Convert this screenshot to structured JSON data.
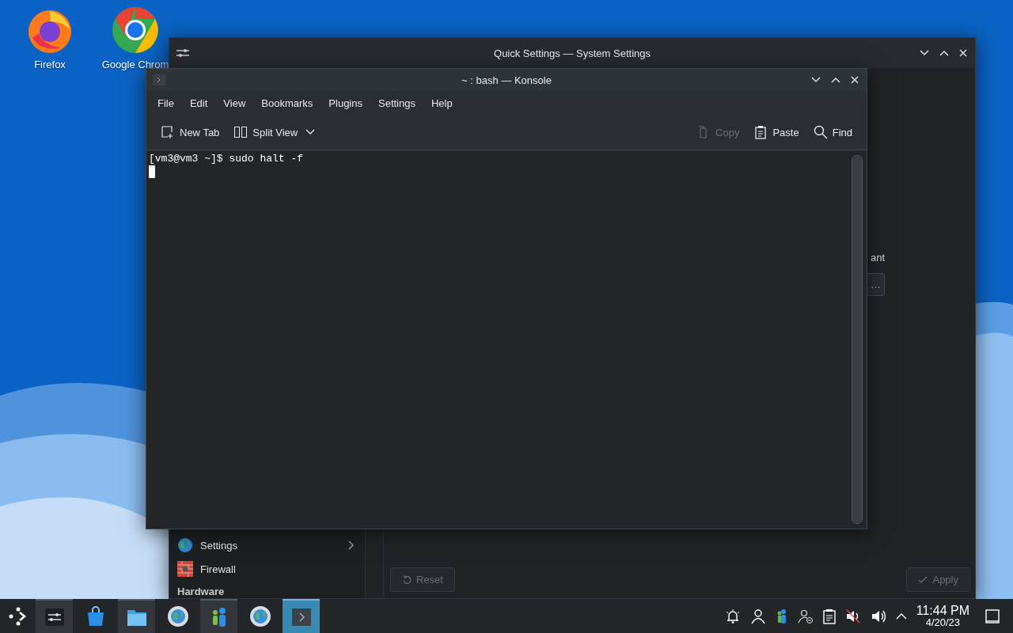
{
  "desktop_icons": [
    {
      "kind": "firefox",
      "label": "Firefox"
    },
    {
      "kind": "chrome",
      "label": "Google Chrom"
    }
  ],
  "settings_window": {
    "title": "Quick Settings — System Settings",
    "sidebar": {
      "items": [
        {
          "kind": "globe",
          "label": "Settings",
          "has_children": true
        },
        {
          "kind": "firewall",
          "label": "Firewall",
          "has_children": false
        }
      ],
      "section_heading": "Hardware"
    },
    "content": {
      "label": "ant",
      "button": "…"
    },
    "buttons": [
      {
        "kind": "reset",
        "label": "Reset",
        "disabled": true
      },
      {
        "kind": "apply",
        "label": "Apply",
        "disabled": true
      }
    ]
  },
  "konsole": {
    "title": "~ : bash — Konsole",
    "menu": [
      "File",
      "Edit",
      "View",
      "Bookmarks",
      "Plugins",
      "Settings",
      "Help"
    ],
    "toolbar_left": [
      {
        "kind": "new-tab",
        "label": "New Tab",
        "disabled": false
      },
      {
        "kind": "split-view",
        "label": "Split View",
        "disabled": false
      }
    ],
    "toolbar_right": [
      {
        "kind": "copy",
        "label": "Copy",
        "disabled": true
      },
      {
        "kind": "paste",
        "label": "Paste",
        "disabled": false
      },
      {
        "kind": "find",
        "label": "Find",
        "disabled": false
      }
    ],
    "lines": [
      "[vm3@vm3 ~]$ sudo halt -f"
    ],
    "cursor": true
  },
  "taskbar": {
    "tasks": [
      {
        "kind": "settings",
        "selected": false,
        "open": true
      },
      {
        "kind": "store",
        "selected": false,
        "open": false
      },
      {
        "kind": "folder",
        "selected": false,
        "open": true
      },
      {
        "kind": "globe-gear",
        "selected": false,
        "open": false
      },
      {
        "kind": "users",
        "selected": false,
        "open": true
      },
      {
        "kind": "globe-gear",
        "selected": false,
        "open": false
      },
      {
        "kind": "terminal",
        "selected": true,
        "open": true
      }
    ],
    "tray": [
      {
        "kind": "notifications"
      },
      {
        "kind": "user"
      },
      {
        "kind": "users"
      },
      {
        "kind": "user-away"
      },
      {
        "kind": "clipboard"
      },
      {
        "kind": "muted"
      },
      {
        "kind": "volume"
      },
      {
        "kind": "expand"
      }
    ],
    "time": "11:44 PM",
    "date": "4/20/23"
  }
}
